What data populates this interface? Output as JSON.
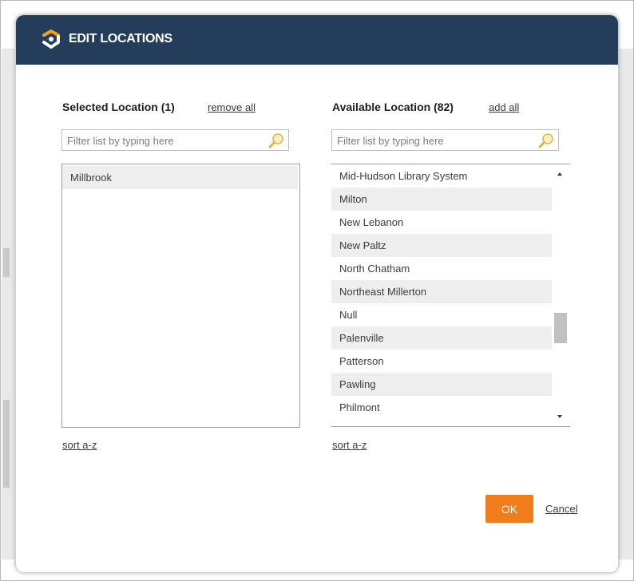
{
  "dialog": {
    "title": "EDIT LOCATIONS",
    "logo_icon": "brand-logo-icon",
    "header_color": "#233d5b",
    "accent_color": "#f07c1a"
  },
  "selected_panel": {
    "heading": "Selected Location (1)",
    "action_link": "remove all",
    "filter_placeholder": "Filter list by typing here",
    "filter_value": "",
    "filter_icon": "search-icon",
    "items": [
      "Millbrook"
    ],
    "sort_link": "sort a-z"
  },
  "available_panel": {
    "heading": "Available Location (82)",
    "action_link": "add all",
    "filter_placeholder": "Filter list by typing here",
    "filter_value": "",
    "filter_icon": "search-icon",
    "items": [
      "Mid-Hudson Library System",
      "Milton",
      "New Lebanon",
      "New Paltz",
      "North Chatham",
      "Northeast Millerton",
      "Null",
      "Palenville",
      "Patterson",
      "Pawling",
      "Philmont"
    ],
    "sort_link": "sort a-z"
  },
  "footer": {
    "ok_label": "OK",
    "cancel_label": "Cancel"
  }
}
